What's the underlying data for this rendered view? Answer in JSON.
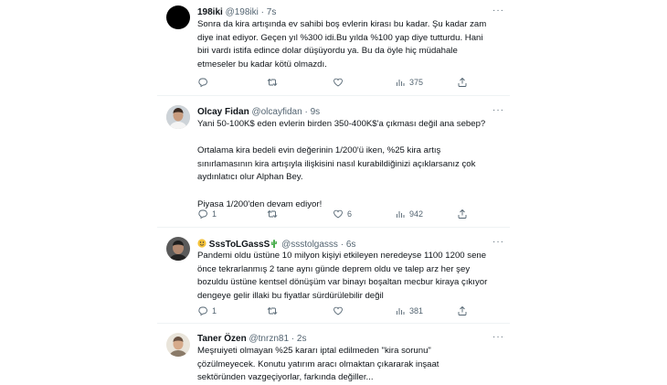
{
  "tweets": [
    {
      "name": "198iki",
      "handle": "@198iki",
      "time": "7s",
      "lines": [
        "Sonra da kira artışında ev sahibi boş evlerin kirası bu kadar. Şu kadar zam",
        "diye inat ediyor. Geçen yıl %300 idi.Bu yılda %100 yap diye tutturdu. Hani",
        "biri vardı istifa edince dolar düşüyordu ya. Bu da öyle hiç müdahale",
        "etmeseler bu kadar kötü olmazdı."
      ],
      "views": "375"
    },
    {
      "name": "Olcay Fidan",
      "handle": "@olcayfidan",
      "time": "9s",
      "lines": [
        "Yani 50-100K$ eden evlerin birden 350-400K$'a çıkması değil ana sebep?",
        "",
        "Ortalama kira bedeli evin değerinin 1/200'ü iken, %25 kira artış",
        "sınırlamasının kira artışıyla ilişkisini nasıl kurabildiğinizi açıklarsanız çok",
        "aydınlatıcı olur Alphan Bey.",
        "",
        "Piyasa 1/200'den devam ediyor!"
      ],
      "replies": "1",
      "likes": "6",
      "views": "942"
    },
    {
      "name": "SssToLGassS",
      "handle": "@ssstolgasss",
      "time": "6s",
      "lines": [
        "Pandemi oldu üstüne 10 milyon kişiyi etkileyen neredeyse 1100 1200 sene",
        "önce tekrarlanmış 2 tane aynı günde deprem oldu ve talep arz her şey",
        "bozuldu üstüne kentsel dönüşüm var binayı boşaltan mecbur kiraya çıkıyor",
        "dengeye gelir illaki bu fiyatlar sürdürülebilir değil"
      ],
      "replies": "1",
      "views": "381"
    },
    {
      "name": "Taner Özen",
      "handle": "@tnrzn81",
      "time": "2s",
      "lines": [
        "Meşruiyeti olmayan %25 kararı iptal edilmeden \"kira sorunu\"",
        "çözülmeyecek. Konutu yatırım aracı olmaktan çıkararak inşaat",
        "sektöründen vazgeçiyorlar, farkında değiller..."
      ]
    }
  ],
  "colors": {
    "text": "#0f1419",
    "muted": "#536471",
    "divider": "#eff3f4"
  }
}
